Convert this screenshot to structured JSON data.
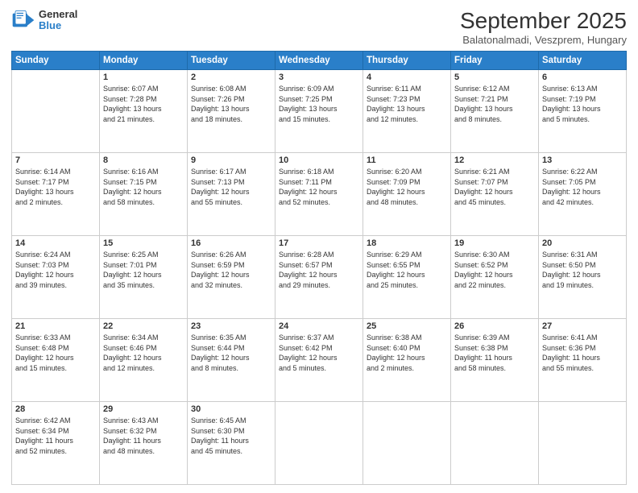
{
  "header": {
    "logo_line1": "General",
    "logo_line2": "Blue",
    "title": "September 2025",
    "subtitle": "Balatonalmadi, Veszprem, Hungary"
  },
  "weekdays": [
    "Sunday",
    "Monday",
    "Tuesday",
    "Wednesday",
    "Thursday",
    "Friday",
    "Saturday"
  ],
  "weeks": [
    [
      {
        "day": "",
        "text": ""
      },
      {
        "day": "1",
        "text": "Sunrise: 6:07 AM\nSunset: 7:28 PM\nDaylight: 13 hours\nand 21 minutes."
      },
      {
        "day": "2",
        "text": "Sunrise: 6:08 AM\nSunset: 7:26 PM\nDaylight: 13 hours\nand 18 minutes."
      },
      {
        "day": "3",
        "text": "Sunrise: 6:09 AM\nSunset: 7:25 PM\nDaylight: 13 hours\nand 15 minutes."
      },
      {
        "day": "4",
        "text": "Sunrise: 6:11 AM\nSunset: 7:23 PM\nDaylight: 13 hours\nand 12 minutes."
      },
      {
        "day": "5",
        "text": "Sunrise: 6:12 AM\nSunset: 7:21 PM\nDaylight: 13 hours\nand 8 minutes."
      },
      {
        "day": "6",
        "text": "Sunrise: 6:13 AM\nSunset: 7:19 PM\nDaylight: 13 hours\nand 5 minutes."
      }
    ],
    [
      {
        "day": "7",
        "text": "Sunrise: 6:14 AM\nSunset: 7:17 PM\nDaylight: 13 hours\nand 2 minutes."
      },
      {
        "day": "8",
        "text": "Sunrise: 6:16 AM\nSunset: 7:15 PM\nDaylight: 12 hours\nand 58 minutes."
      },
      {
        "day": "9",
        "text": "Sunrise: 6:17 AM\nSunset: 7:13 PM\nDaylight: 12 hours\nand 55 minutes."
      },
      {
        "day": "10",
        "text": "Sunrise: 6:18 AM\nSunset: 7:11 PM\nDaylight: 12 hours\nand 52 minutes."
      },
      {
        "day": "11",
        "text": "Sunrise: 6:20 AM\nSunset: 7:09 PM\nDaylight: 12 hours\nand 48 minutes."
      },
      {
        "day": "12",
        "text": "Sunrise: 6:21 AM\nSunset: 7:07 PM\nDaylight: 12 hours\nand 45 minutes."
      },
      {
        "day": "13",
        "text": "Sunrise: 6:22 AM\nSunset: 7:05 PM\nDaylight: 12 hours\nand 42 minutes."
      }
    ],
    [
      {
        "day": "14",
        "text": "Sunrise: 6:24 AM\nSunset: 7:03 PM\nDaylight: 12 hours\nand 39 minutes."
      },
      {
        "day": "15",
        "text": "Sunrise: 6:25 AM\nSunset: 7:01 PM\nDaylight: 12 hours\nand 35 minutes."
      },
      {
        "day": "16",
        "text": "Sunrise: 6:26 AM\nSunset: 6:59 PM\nDaylight: 12 hours\nand 32 minutes."
      },
      {
        "day": "17",
        "text": "Sunrise: 6:28 AM\nSunset: 6:57 PM\nDaylight: 12 hours\nand 29 minutes."
      },
      {
        "day": "18",
        "text": "Sunrise: 6:29 AM\nSunset: 6:55 PM\nDaylight: 12 hours\nand 25 minutes."
      },
      {
        "day": "19",
        "text": "Sunrise: 6:30 AM\nSunset: 6:52 PM\nDaylight: 12 hours\nand 22 minutes."
      },
      {
        "day": "20",
        "text": "Sunrise: 6:31 AM\nSunset: 6:50 PM\nDaylight: 12 hours\nand 19 minutes."
      }
    ],
    [
      {
        "day": "21",
        "text": "Sunrise: 6:33 AM\nSunset: 6:48 PM\nDaylight: 12 hours\nand 15 minutes."
      },
      {
        "day": "22",
        "text": "Sunrise: 6:34 AM\nSunset: 6:46 PM\nDaylight: 12 hours\nand 12 minutes."
      },
      {
        "day": "23",
        "text": "Sunrise: 6:35 AM\nSunset: 6:44 PM\nDaylight: 12 hours\nand 8 minutes."
      },
      {
        "day": "24",
        "text": "Sunrise: 6:37 AM\nSunset: 6:42 PM\nDaylight: 12 hours\nand 5 minutes."
      },
      {
        "day": "25",
        "text": "Sunrise: 6:38 AM\nSunset: 6:40 PM\nDaylight: 12 hours\nand 2 minutes."
      },
      {
        "day": "26",
        "text": "Sunrise: 6:39 AM\nSunset: 6:38 PM\nDaylight: 11 hours\nand 58 minutes."
      },
      {
        "day": "27",
        "text": "Sunrise: 6:41 AM\nSunset: 6:36 PM\nDaylight: 11 hours\nand 55 minutes."
      }
    ],
    [
      {
        "day": "28",
        "text": "Sunrise: 6:42 AM\nSunset: 6:34 PM\nDaylight: 11 hours\nand 52 minutes."
      },
      {
        "day": "29",
        "text": "Sunrise: 6:43 AM\nSunset: 6:32 PM\nDaylight: 11 hours\nand 48 minutes."
      },
      {
        "day": "30",
        "text": "Sunrise: 6:45 AM\nSunset: 6:30 PM\nDaylight: 11 hours\nand 45 minutes."
      },
      {
        "day": "",
        "text": ""
      },
      {
        "day": "",
        "text": ""
      },
      {
        "day": "",
        "text": ""
      },
      {
        "day": "",
        "text": ""
      }
    ]
  ]
}
